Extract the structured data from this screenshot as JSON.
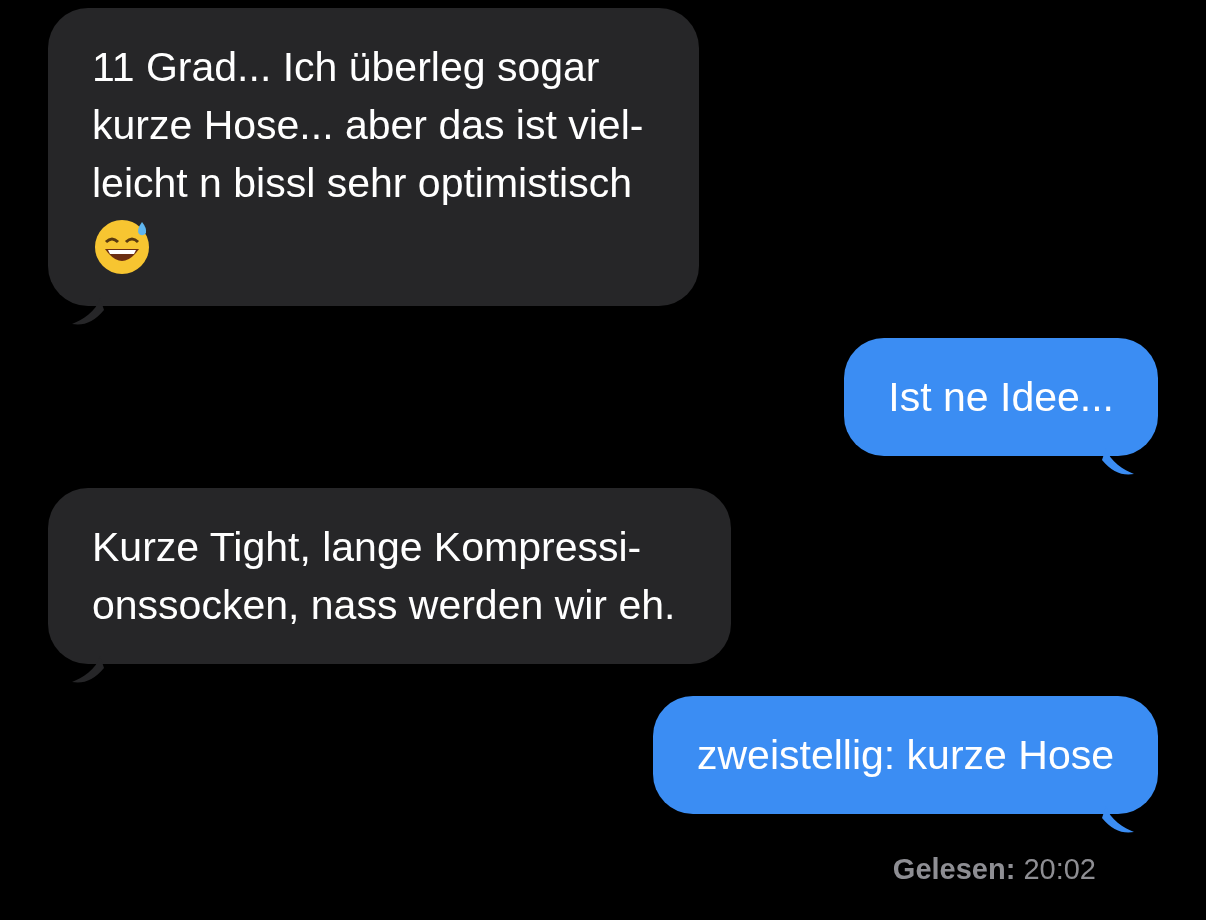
{
  "messages": [
    {
      "kind": "incoming",
      "lines": [
        "11 Grad... Ich überleg sogar",
        "kurze Hose... aber das ist viel-",
        "leicht n bissl sehr optimistisch"
      ],
      "emoji_icon": true
    },
    {
      "kind": "outgoing",
      "lines": [
        "Ist ne Idee..."
      ],
      "emoji_icon": false
    },
    {
      "kind": "incoming",
      "lines": [
        "Kurze Tight, lange Kompressi-",
        "onssocken, nass werden wir eh."
      ],
      "emoji_icon": false
    },
    {
      "kind": "outgoing",
      "lines": [
        "zweistellig: kurze Hose"
      ],
      "emoji_icon": false
    }
  ],
  "receipt": {
    "label": "Gelesen:",
    "time": "20:02"
  }
}
